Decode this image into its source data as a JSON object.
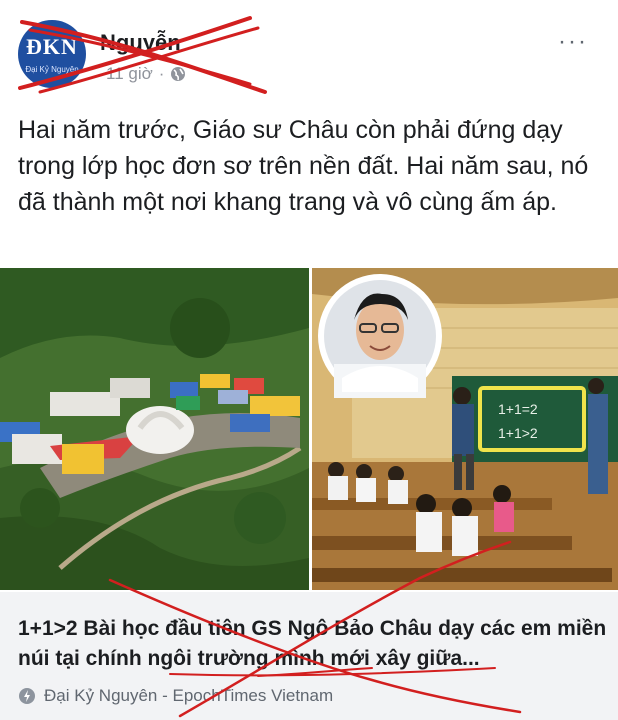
{
  "header": {
    "avatar_text": "ĐKN",
    "avatar_subtext": "Đại Kỷ Nguyên",
    "page_name": "Nguyễn",
    "timestamp": "11 giờ",
    "separator": "·",
    "more_label": "···"
  },
  "post": {
    "text": "Hai năm trước, Giáo sư Châu còn phải đứng dạy trong lớp học đơn sơ trên nền đất. Hai năm sau, nó đã thành một nơi khang trang và vô cùng ấm áp."
  },
  "photos": {
    "left": "school-aerial-photo",
    "right": "classroom-photo",
    "blackboard": [
      "1+1=2",
      "1+1>2"
    ]
  },
  "link": {
    "title": "1+1>2 Bài học đầu tiên GS Ngô Bảo Châu dạy các em miền núi tại chính ngôi trường mình mới xây giữa...",
    "source": "Đại Kỷ Nguyên - EpochTimes Vietnam"
  },
  "colors": {
    "scribble": "#d21f1f",
    "avatar_bg": "#1f4fa0",
    "card_bg": "#f2f3f5"
  }
}
